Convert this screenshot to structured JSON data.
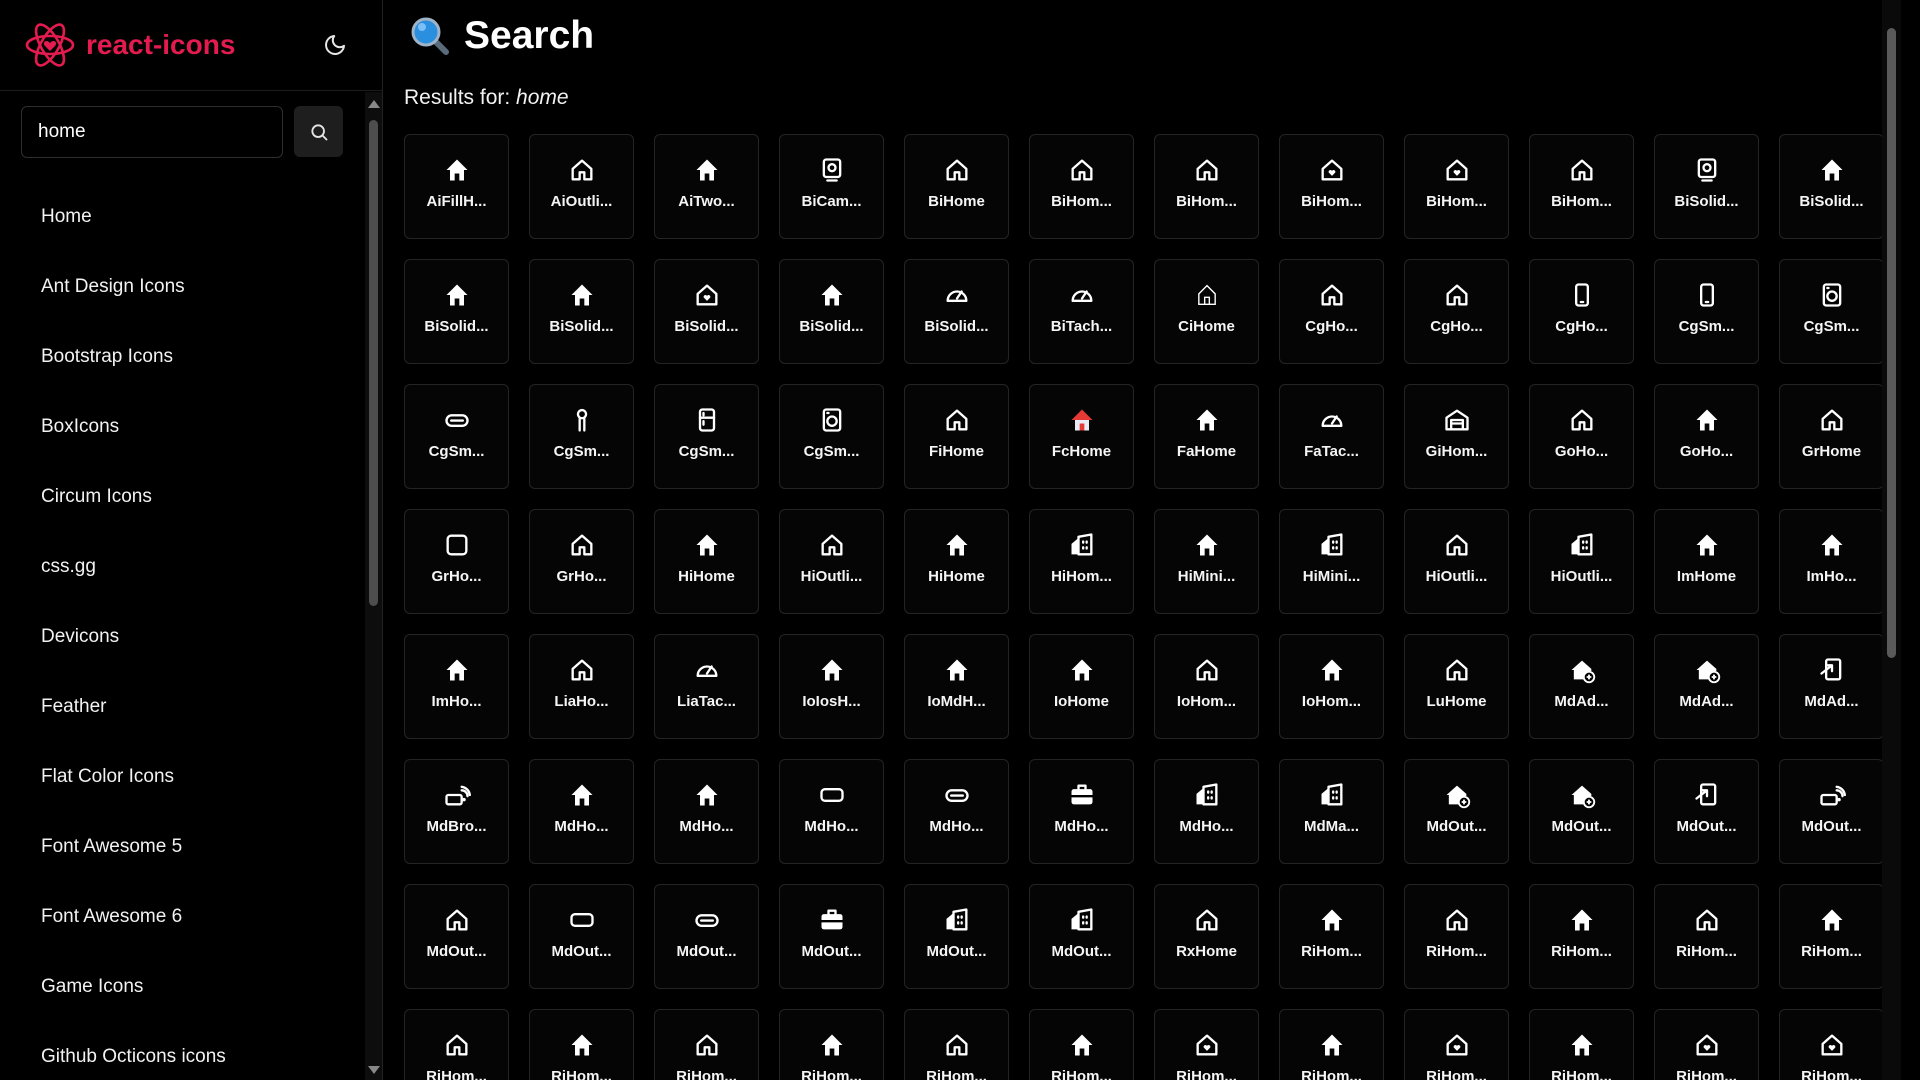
{
  "brand": {
    "title": "react-icons",
    "logo_icon": "react-atom-logo-icon",
    "accent": "#e31b4f"
  },
  "theme_toggle": {
    "icon": "moon-icon"
  },
  "search": {
    "value": "home",
    "placeholder": "",
    "button_icon": "search-icon"
  },
  "nav": {
    "items": [
      "Home",
      "Ant Design Icons",
      "Bootstrap Icons",
      "BoxIcons",
      "Circum Icons",
      "css.gg",
      "Devicons",
      "Feather",
      "Flat Color Icons",
      "Font Awesome 5",
      "Font Awesome 6",
      "Game Icons",
      "Github Octicons icons"
    ]
  },
  "page": {
    "title": "Search",
    "title_icon": "magnifying-glass-emoji-icon",
    "results_prefix": "Results for:",
    "results_query": "home"
  },
  "icons": [
    "AiFillH...",
    "AiOutli...",
    "AiTwo...",
    "BiCam...",
    "BiHome",
    "BiHom...",
    "BiHom...",
    "BiHom...",
    "BiHom...",
    "BiHom...",
    "BiSolid...",
    "BiSolid...",
    "BiSolid...",
    "BiSolid...",
    "BiSolid...",
    "BiSolid...",
    "BiSolid...",
    "BiTach...",
    "CiHome",
    "CgHo...",
    "CgHo...",
    "CgHo...",
    "CgSm...",
    "CgSm...",
    "CgSm...",
    "CgSm...",
    "CgSm...",
    "CgSm...",
    "FiHome",
    "FcHome",
    "FaHome",
    "FaTac...",
    "GiHom...",
    "GoHo...",
    "GoHo...",
    "GrHome",
    "GrHo...",
    "GrHo...",
    "HiHome",
    "HiOutli...",
    "HiHome",
    "HiHom...",
    "HiMini...",
    "HiMini...",
    "HiOutli...",
    "HiOutli...",
    "ImHome",
    "ImHo...",
    "ImHo...",
    "LiaHo...",
    "LiaTac...",
    "IoIosH...",
    "IoMdH...",
    "IoHome",
    "IoHom...",
    "IoHom...",
    "LuHome",
    "MdAd...",
    "MdAd...",
    "MdAd...",
    "MdBro...",
    "MdHo...",
    "MdHo...",
    "MdHo...",
    "MdHo...",
    "MdHo...",
    "MdHo...",
    "MdMa...",
    "MdOut...",
    "MdOut...",
    "MdOut...",
    "MdOut...",
    "MdOut...",
    "MdOut...",
    "MdOut...",
    "MdOut...",
    "MdOut...",
    "MdOut...",
    "RxHome",
    "RiHom...",
    "RiHom...",
    "RiHom...",
    "RiHom...",
    "RiHom...",
    "RiHom...",
    "RiHom...",
    "RiHom...",
    "RiHom...",
    "RiHom...",
    "RiHom...",
    "RiHom...",
    "RiHom...",
    "RiHom...",
    "RiHom...",
    "RiHom...",
    "RiHom..."
  ],
  "icon_kinds": [
    "house-fill",
    "house-outline",
    "house-fill",
    "camera-home",
    "house-outline",
    "house-outline",
    "house-outline",
    "house-heart",
    "house-heart",
    "house-outline",
    "camera-home",
    "house-fill",
    "house-fill",
    "house-fill",
    "house-heart",
    "house-fill",
    "gauge",
    "gauge",
    "house-thin",
    "house-outline",
    "house-outline",
    "phone",
    "phone",
    "washer",
    "pill",
    "person",
    "fridge",
    "washer",
    "house-outline",
    "house-color",
    "house-fill",
    "gauge",
    "garage",
    "house-outline",
    "house-fill",
    "house-outline",
    "square",
    "house-outline",
    "house-fill",
    "house-outline",
    "house-fill",
    "building",
    "house-fill",
    "building",
    "house-outline",
    "building",
    "house-fill",
    "house-fill",
    "house-fill",
    "house-outline",
    "gauge",
    "house-fill",
    "house-fill",
    "house-fill",
    "house-outline",
    "house-fill",
    "house-outline",
    "house-plus",
    "house-plus",
    "add-home",
    "router",
    "house-fill",
    "house-fill",
    "rounded-rect",
    "pill",
    "briefcase",
    "building",
    "building",
    "house-plus",
    "house-plus",
    "add-home",
    "router",
    "house-outline",
    "rounded-rect",
    "pill",
    "briefcase",
    "building",
    "building",
    "house-outline",
    "house-fill",
    "house-outline",
    "house-fill",
    "house-outline",
    "house-fill",
    "house-outline",
    "house-fill",
    "house-outline",
    "house-fill",
    "house-outline",
    "house-fill",
    "house-heart",
    "house-fill",
    "house-heart",
    "house-fill",
    "house-heart",
    "house-heart"
  ],
  "colors": {
    "background": "#000000",
    "tile_border": "#242424",
    "text": "#ffffff",
    "fc_home_roof": "#e53935"
  }
}
